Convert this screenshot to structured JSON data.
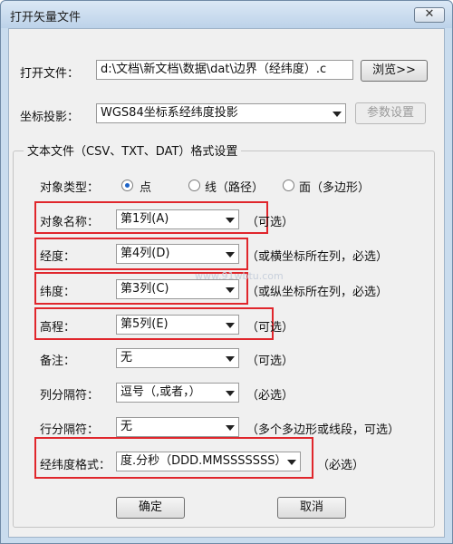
{
  "window": {
    "title": "打开矢量文件",
    "close_glyph": "✕"
  },
  "file": {
    "label": "打开文件：",
    "value": "d:\\文档\\新文档\\数据\\dat\\边界（经纬度）.c",
    "browse": "浏览>>"
  },
  "projection": {
    "label": "坐标投影：",
    "value": "WGS84坐标系经纬度投影",
    "param_button": "参数设置"
  },
  "group": {
    "title": "文本文件（CSV、TXT、DAT）格式设置"
  },
  "object_type": {
    "label": "对象类型：",
    "options": [
      {
        "label": "点",
        "checked": true
      },
      {
        "label": "线（路径）",
        "checked": false
      },
      {
        "label": "面（多边形）",
        "checked": false
      }
    ]
  },
  "rows": [
    {
      "label": "对象名称：",
      "value": "第1列(A)",
      "note": "（可选）"
    },
    {
      "label": "经度：",
      "value": "第4列(D)",
      "note": "（或横坐标所在列，必选）"
    },
    {
      "label": "纬度：",
      "value": "第3列(C)",
      "note": "（或纵坐标所在列，必选）"
    },
    {
      "label": "高程：",
      "value": "第5列(E)",
      "note": "（可选）"
    },
    {
      "label": "备注：",
      "value": "无",
      "note": "（可选）"
    },
    {
      "label": "列分隔符：",
      "value": "逗号（,或者，）",
      "note": "（必选）"
    },
    {
      "label": "行分隔符：",
      "value": "无",
      "note": "（多个多边形或线段，可选）"
    }
  ],
  "latlon_format": {
    "label": "经纬度格式：",
    "value": "度.分秒（DDD.MMSSSSSSS）",
    "note": "（必选）"
  },
  "buttons": {
    "ok": "确定",
    "cancel": "取消"
  },
  "watermark": "www.91wbtu.com",
  "colors": {
    "highlight": "#e0262c",
    "title_bar": "#c9dcee",
    "radio_dot": "#1e64c8"
  }
}
